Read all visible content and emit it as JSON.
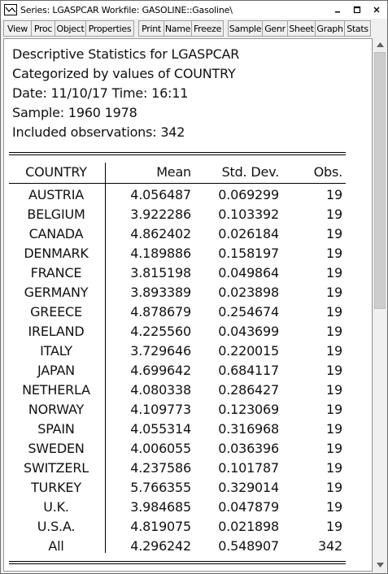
{
  "window": {
    "title": "Series: LGASPCAR   Workfile: GASOLINE::Gasoline\\",
    "minimize_icon": "minimize-icon",
    "maximize_icon": "maximize-icon",
    "close_icon": "close-icon"
  },
  "toolbar": {
    "view": "View",
    "proc": "Proc",
    "object": "Object",
    "properties": "Properties",
    "print": "Print",
    "name": "Name",
    "freeze": "Freeze",
    "sample": "Sample",
    "genr": "Genr",
    "sheet": "Sheet",
    "graph": "Graph",
    "stats": "Stats"
  },
  "output": {
    "line1": "Descriptive Statistics for LGASPCAR",
    "line2": "Categorized by values of COUNTRY",
    "line3": "Date: 11/10/17   Time: 16:11",
    "line4": "Sample: 1960 1978",
    "line5": "Included observations: 342"
  },
  "table": {
    "headers": {
      "country": "COUNTRY",
      "mean": "Mean",
      "std": "Std. Dev.",
      "obs": "Obs."
    },
    "rows": [
      {
        "country": "AUSTRIA",
        "mean": "4.056487",
        "std": "0.069299",
        "obs": "19"
      },
      {
        "country": "BELGIUM",
        "mean": "3.922286",
        "std": "0.103392",
        "obs": "19"
      },
      {
        "country": "CANADA",
        "mean": "4.862402",
        "std": "0.026184",
        "obs": "19"
      },
      {
        "country": "DENMARK",
        "mean": "4.189886",
        "std": "0.158197",
        "obs": "19"
      },
      {
        "country": "FRANCE",
        "mean": "3.815198",
        "std": "0.049864",
        "obs": "19"
      },
      {
        "country": "GERMANY",
        "mean": "3.893389",
        "std": "0.023898",
        "obs": "19"
      },
      {
        "country": "GREECE",
        "mean": "4.878679",
        "std": "0.254674",
        "obs": "19"
      },
      {
        "country": "IRELAND",
        "mean": "4.225560",
        "std": "0.043699",
        "obs": "19"
      },
      {
        "country": "ITALY",
        "mean": "3.729646",
        "std": "0.220015",
        "obs": "19"
      },
      {
        "country": "JAPAN",
        "mean": "4.699642",
        "std": "0.684117",
        "obs": "19"
      },
      {
        "country": "NETHERLA",
        "mean": "4.080338",
        "std": "0.286427",
        "obs": "19"
      },
      {
        "country": "NORWAY",
        "mean": "4.109773",
        "std": "0.123069",
        "obs": "19"
      },
      {
        "country": "SPAIN",
        "mean": "4.055314",
        "std": "0.316968",
        "obs": "19"
      },
      {
        "country": "SWEDEN",
        "mean": "4.006055",
        "std": "0.036396",
        "obs": "19"
      },
      {
        "country": "SWITZERL",
        "mean": "4.237586",
        "std": "0.101787",
        "obs": "19"
      },
      {
        "country": "TURKEY",
        "mean": "5.766355",
        "std": "0.329014",
        "obs": "19"
      },
      {
        "country": "U.K.",
        "mean": "3.984685",
        "std": "0.047879",
        "obs": "19"
      },
      {
        "country": "U.S.A.",
        "mean": "4.819075",
        "std": "0.021898",
        "obs": "19"
      },
      {
        "country": "All",
        "mean": "4.296242",
        "std": "0.548907",
        "obs": "342"
      }
    ]
  },
  "scrollbar": {
    "up_icon": "scroll-up-arrow-icon",
    "down_icon": "scroll-down-arrow-icon"
  }
}
